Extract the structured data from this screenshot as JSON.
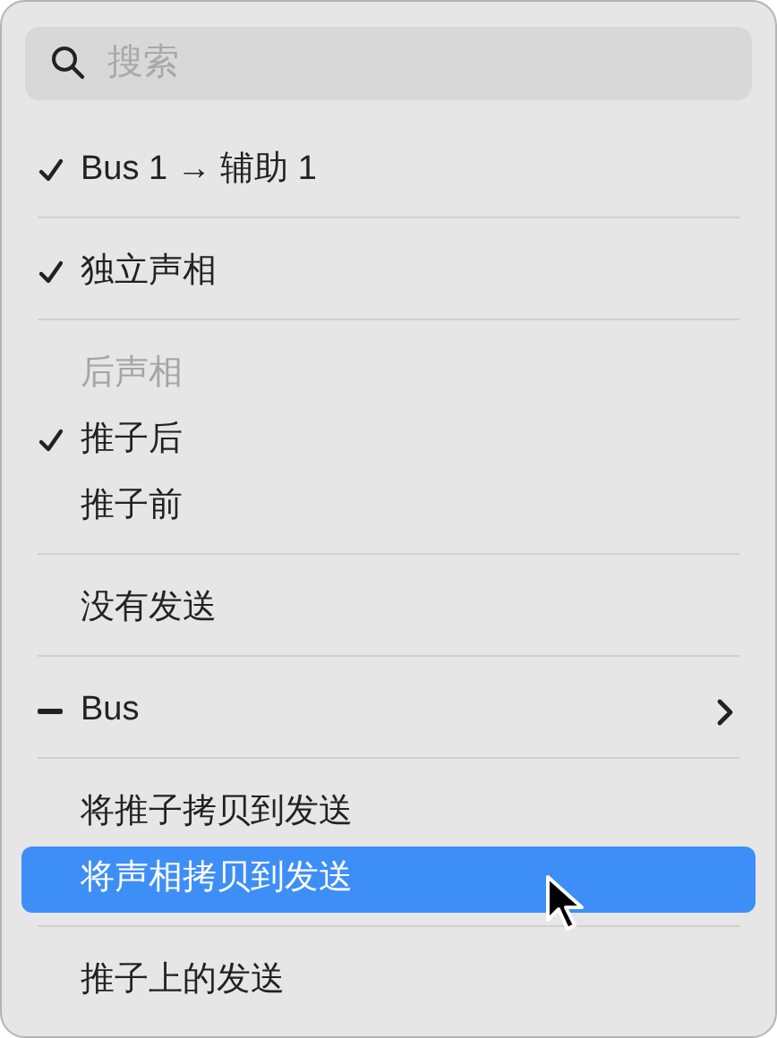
{
  "search": {
    "placeholder": "搜索"
  },
  "items": [
    {
      "kind": "item",
      "label": "Bus 1 → 辅助 1",
      "checked": true,
      "mixed": false,
      "submenu": false,
      "selected": false
    },
    {
      "kind": "separator"
    },
    {
      "kind": "item",
      "label": "独立声相",
      "checked": true,
      "mixed": false,
      "submenu": false,
      "selected": false
    },
    {
      "kind": "separator"
    },
    {
      "kind": "header",
      "label": "后声相"
    },
    {
      "kind": "item",
      "label": "推子后",
      "checked": true,
      "mixed": false,
      "submenu": false,
      "selected": false
    },
    {
      "kind": "item",
      "label": "推子前",
      "checked": false,
      "mixed": false,
      "submenu": false,
      "selected": false
    },
    {
      "kind": "separator"
    },
    {
      "kind": "item",
      "label": "没有发送",
      "checked": false,
      "mixed": false,
      "submenu": false,
      "selected": false
    },
    {
      "kind": "separator"
    },
    {
      "kind": "item",
      "label": "Bus",
      "checked": false,
      "mixed": true,
      "submenu": true,
      "selected": false
    },
    {
      "kind": "separator"
    },
    {
      "kind": "item",
      "label": "将推子拷贝到发送",
      "checked": false,
      "mixed": false,
      "submenu": false,
      "selected": false
    },
    {
      "kind": "item",
      "label": "将声相拷贝到发送",
      "checked": false,
      "mixed": false,
      "submenu": false,
      "selected": true
    },
    {
      "kind": "separator"
    },
    {
      "kind": "item",
      "label": "推子上的发送",
      "checked": false,
      "mixed": false,
      "submenu": false,
      "selected": false
    }
  ]
}
